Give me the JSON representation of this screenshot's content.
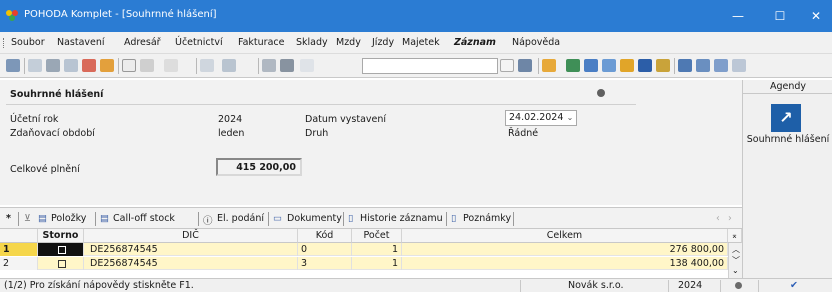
{
  "window": {
    "title": "POHODA Komplet - [Souhrnné hlášení]",
    "minimize": "—",
    "maximize": "☐",
    "close": "✕"
  },
  "menu": [
    {
      "label": "Soubor"
    },
    {
      "label": "Nastavení"
    },
    {
      "label": "Adresář"
    },
    {
      "label": "Účetnictví"
    },
    {
      "label": "Fakturace"
    },
    {
      "label": "Sklady"
    },
    {
      "label": "Mzdy"
    },
    {
      "label": "Jízdy"
    },
    {
      "label": "Majetek"
    },
    {
      "label": "Záznam"
    },
    {
      "label": "Nápověda"
    }
  ],
  "form": {
    "heading": "Souhrnné hlášení",
    "ucetni_rok_label": "Účetní rok",
    "ucetni_rok_value": "2024",
    "obdobi_label": "Zdaňovací období",
    "obdobi_value": "leden",
    "datum_label": "Datum vystavení",
    "datum_value": "24.02.2024",
    "druh_label": "Druh",
    "druh_value": "Řádné",
    "plneni_label": "Celkové plnění",
    "plneni_value": "415 200,00"
  },
  "agendy": {
    "header": "Agendy",
    "item_label": "Souhrnné hlášení"
  },
  "tabs": [
    {
      "label": "Položky"
    },
    {
      "label": "Call-off stock"
    },
    {
      "label": "El. podání"
    },
    {
      "label": "Dokumenty"
    },
    {
      "label": "Historie záznamu"
    },
    {
      "label": "Poznámky"
    }
  ],
  "grid": {
    "columns": [
      "Storno",
      "DIČ",
      "Kód",
      "Počet",
      "Celkem"
    ],
    "rows": [
      {
        "num": "1",
        "storno": false,
        "dic": "DE256874545",
        "kod": "0",
        "pocet": "1",
        "celkem": "276 800,00"
      },
      {
        "num": "2",
        "storno": false,
        "dic": "DE256874545",
        "kod": "3",
        "pocet": "1",
        "celkem": "138 400,00"
      }
    ]
  },
  "statusbar": {
    "hint": "(1/2) Pro získání nápovědy stiskněte F1.",
    "company": "Novák s.r.o.",
    "year": "2024"
  },
  "colors": {
    "titlebar": "#2b7cd3",
    "selected_row": "#fff6c8",
    "agenda_tile": "#1e5fa8"
  }
}
